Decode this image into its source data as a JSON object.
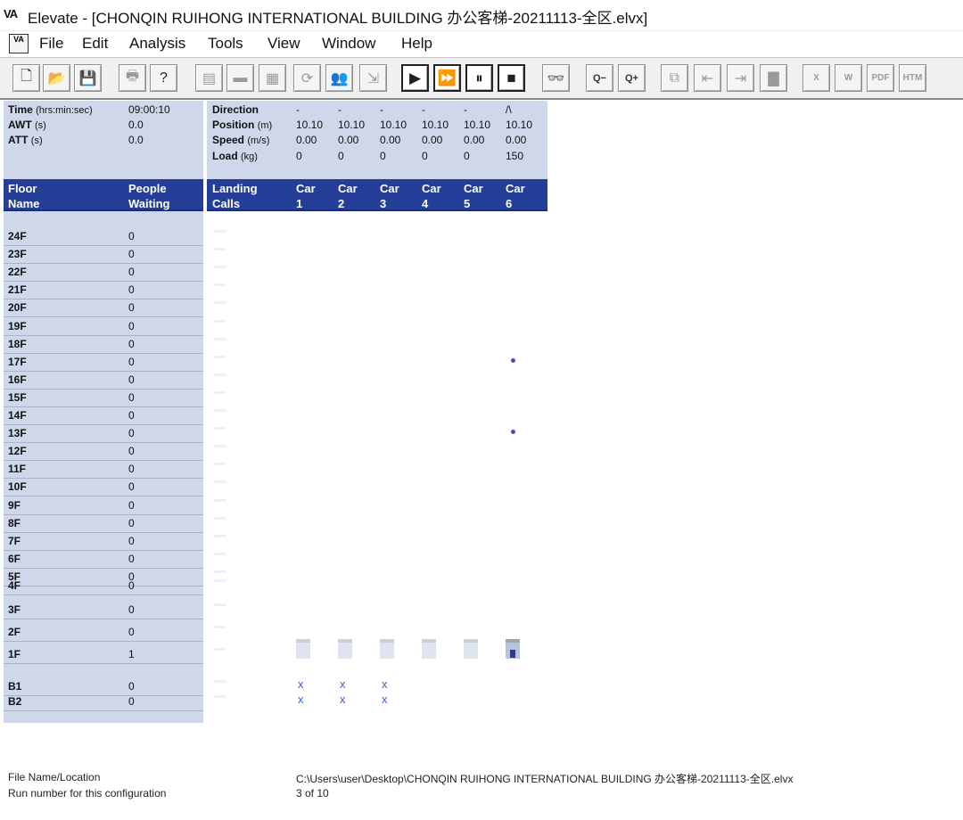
{
  "window": {
    "logo": "VA",
    "title": "Elevate - [CHONQIN RUIHONG INTERNATIONAL BUILDING 办公客梯-20211113-全区.elvx]"
  },
  "menu": {
    "app_icon": "VA",
    "items": [
      "File",
      "Edit",
      "Analysis",
      "Tools",
      "View",
      "Window",
      "Help"
    ]
  },
  "toolbar": {
    "buttons": [
      {
        "name": "new-icon",
        "glyph": "🗋"
      },
      {
        "name": "open-icon",
        "glyph": "📂"
      },
      {
        "name": "save-icon",
        "glyph": "💾"
      },
      {
        "name": "print-icon",
        "glyph": "🖶"
      },
      {
        "name": "help-icon",
        "glyph": "?"
      },
      {
        "name": "building-data-icon",
        "glyph": "▤"
      },
      {
        "name": "floor-data-icon",
        "glyph": "▬"
      },
      {
        "name": "elevator-data-icon",
        "glyph": "▦"
      },
      {
        "name": "dispatch-icon",
        "glyph": "⟳"
      },
      {
        "name": "passenger-data-icon",
        "glyph": "👥"
      },
      {
        "name": "journey-icon",
        "glyph": "⇲"
      },
      {
        "name": "play-icon",
        "glyph": "▶"
      },
      {
        "name": "fast-forward-icon",
        "glyph": "⏩"
      },
      {
        "name": "pause-icon",
        "glyph": "⏸"
      },
      {
        "name": "stop-icon",
        "glyph": "■"
      },
      {
        "name": "binoculars-icon",
        "glyph": "👓"
      },
      {
        "name": "zoom-out-icon",
        "glyph": "Q−"
      },
      {
        "name": "zoom-in-icon",
        "glyph": "Q+"
      },
      {
        "name": "copy-report-icon",
        "glyph": "⧉"
      },
      {
        "name": "export-back-icon",
        "glyph": "⇤"
      },
      {
        "name": "export-forward-icon",
        "glyph": "⇥"
      },
      {
        "name": "chart-icon",
        "glyph": "▇"
      },
      {
        "name": "excel-icon",
        "glyph": "X"
      },
      {
        "name": "word-icon",
        "glyph": "W"
      },
      {
        "name": "pdf-icon",
        "glyph": "PDF"
      },
      {
        "name": "html-icon",
        "glyph": "HTM"
      }
    ]
  },
  "status": {
    "time_label": "Time",
    "time_unit": "(hrs:min:sec)",
    "time_value": "09:00:10",
    "awt_label": "AWT",
    "awt_unit": "(s)",
    "awt_value": "0.0",
    "att_label": "ATT",
    "att_unit": "(s)",
    "att_value": "0.0"
  },
  "cars_status": {
    "direction_label": "Direction",
    "position_label": "Position",
    "position_unit": "(m)",
    "speed_label": "Speed",
    "speed_unit": "(m/s)",
    "load_label": "Load",
    "load_unit": "(kg)",
    "cars": [
      {
        "direction": "-",
        "position": "10.10",
        "speed": "0.00",
        "load": "0"
      },
      {
        "direction": "-",
        "position": "10.10",
        "speed": "0.00",
        "load": "0"
      },
      {
        "direction": "-",
        "position": "10.10",
        "speed": "0.00",
        "load": "0"
      },
      {
        "direction": "-",
        "position": "10.10",
        "speed": "0.00",
        "load": "0"
      },
      {
        "direction": "-",
        "position": "10.10",
        "speed": "0.00",
        "load": "0"
      },
      {
        "direction": "/\\",
        "position": "10.10",
        "speed": "0.00",
        "load": "150"
      }
    ]
  },
  "headers": {
    "floor_name": [
      "Floor",
      "Name"
    ],
    "people_waiting": [
      "People",
      "Waiting"
    ],
    "landing_calls": [
      "Landing",
      "Calls"
    ],
    "cars": [
      [
        "Car",
        "1"
      ],
      [
        "Car",
        "2"
      ],
      [
        "Car",
        "3"
      ],
      [
        "Car",
        "4"
      ],
      [
        "Car",
        "5"
      ],
      [
        "Car",
        "6"
      ]
    ]
  },
  "floors": [
    {
      "name": "24F",
      "people": "0"
    },
    {
      "name": "23F",
      "people": "0"
    },
    {
      "name": "22F",
      "people": "0"
    },
    {
      "name": "21F",
      "people": "0"
    },
    {
      "name": "20F",
      "people": "0"
    },
    {
      "name": "19F",
      "people": "0"
    },
    {
      "name": "18F",
      "people": "0"
    },
    {
      "name": "17F",
      "people": "0"
    },
    {
      "name": "16F",
      "people": "0"
    },
    {
      "name": "15F",
      "people": "0"
    },
    {
      "name": "14F",
      "people": "0"
    },
    {
      "name": "13F",
      "people": "0"
    },
    {
      "name": "12F",
      "people": "0"
    },
    {
      "name": "11F",
      "people": "0"
    },
    {
      "name": "10F",
      "people": "0"
    },
    {
      "name": "9F",
      "people": "0"
    },
    {
      "name": "8F",
      "people": "0"
    },
    {
      "name": "7F",
      "people": "0"
    },
    {
      "name": "6F",
      "people": "0"
    },
    {
      "name": "5F",
      "people": "0"
    },
    {
      "name": "4F",
      "people": "0"
    },
    {
      "name": "3F",
      "people": "0"
    },
    {
      "name": "2F",
      "people": "0"
    },
    {
      "name": "1F",
      "people": "1"
    },
    {
      "name": "B1",
      "people": "0"
    },
    {
      "name": "B2",
      "people": "0"
    }
  ],
  "car_calls": {
    "17F": [
      6
    ],
    "13F": [
      6
    ]
  },
  "car_restrictions": {
    "symbol": "x",
    "B1": [
      1,
      2,
      3
    ],
    "B2": [
      1,
      2,
      3
    ]
  },
  "car_locations": {
    "floor": "1F",
    "loaded_car": 6
  },
  "footer": {
    "file_label": "File Name/Location",
    "file_value": "C:\\Users\\user\\Desktop\\CHONQIN RUIHONG INTERNATIONAL BUILDING 办公客梯-20211113-全区.elvx",
    "run_label": "Run number for this configuration",
    "run_value": "3 of 10"
  },
  "colors": {
    "panel": "#cfd8ea",
    "header": "#253e98",
    "header_text": "#ffffff",
    "accent": "#3a5fc8"
  }
}
